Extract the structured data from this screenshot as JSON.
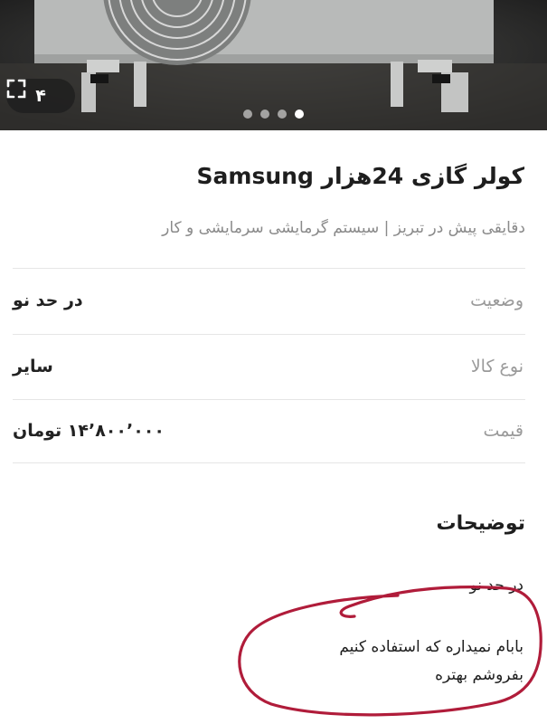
{
  "gallery": {
    "photo_count": "۴",
    "expand_icon": "expand-icon",
    "total_dots": 4,
    "active_dot": 4
  },
  "listing": {
    "title": "کولر گازی 24هزار Samsung",
    "subtitle": "دقایقی پیش در تبریز | سیستم گرمایشی سرمایشی و کار"
  },
  "attributes": [
    {
      "label": "وضعیت",
      "value": "در حد نو"
    },
    {
      "label": "نوع کالا",
      "value": "سایر"
    },
    {
      "label": "قیمت",
      "value": "۱۴٬۸۰۰٬۰۰۰ تومان"
    }
  ],
  "description": {
    "heading": "توضیحات",
    "lines": [
      "در حد نو",
      "بابام نمیداره که استفاده کنیم",
      "بفروشم بهتره"
    ]
  },
  "colors": {
    "annotation": "#b01c3a",
    "label_gray": "#9a9a9a",
    "text_dark": "#1e1e1e"
  }
}
